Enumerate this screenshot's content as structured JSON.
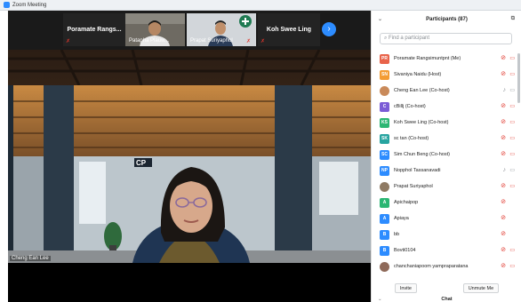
{
  "window": {
    "title": "Zoom Meeting"
  },
  "gallery": {
    "tiles": [
      {
        "name": "Poramate Rangs...",
        "muted": true
      },
      {
        "name": "Patapha Plauw...",
        "muted": true
      },
      {
        "name": "Prapat Suriyaphol",
        "muted": true
      },
      {
        "name": "Koh Swee Ling",
        "muted": true
      }
    ],
    "next_icon": "chevron-right-icon"
  },
  "main_video": {
    "speaker_name": "Cheng Ean Lee"
  },
  "participants_panel": {
    "title": "Participants (87)",
    "search_placeholder": "Find a participant",
    "participants": [
      {
        "initials": "PR",
        "name": "Poramate Rangsimuntpnt (Me)",
        "color": "#e8634a",
        "photo": false,
        "mic": "muted",
        "cam": "muted"
      },
      {
        "initials": "SN",
        "name": "Sivaniya Naidu (Host)",
        "color": "#f39c34",
        "photo": false,
        "mic": "muted",
        "cam": "muted"
      },
      {
        "initials": "",
        "name": "Cheng Ean Lee (Co-host)",
        "color": "#c98a5a",
        "photo": true,
        "mic": "on",
        "cam": "on"
      },
      {
        "initials": "C",
        "name": "cBillj (Co-host)",
        "color": "#7b5cd6",
        "photo": false,
        "mic": "muted",
        "cam": "muted"
      },
      {
        "initials": "KS",
        "name": "Koh Swee Ling (Co-host)",
        "color": "#2bb673",
        "photo": false,
        "mic": "muted",
        "cam": "muted"
      },
      {
        "initials": "SK",
        "name": "sc tan (Co-host)",
        "color": "#27a4a0",
        "photo": false,
        "mic": "muted",
        "cam": "muted"
      },
      {
        "initials": "SC",
        "name": "Sim Chun Beng (Co-host)",
        "color": "#2d8cff",
        "photo": false,
        "mic": "muted",
        "cam": "muted"
      },
      {
        "initials": "NP",
        "name": "Nopphol Tassanavadi",
        "color": "#2d8cff",
        "photo": false,
        "mic": "on",
        "cam": "on"
      },
      {
        "initials": "",
        "name": "Prapat Suriyaphol",
        "color": "#8f7a63",
        "photo": true,
        "mic": "muted",
        "cam": "muted"
      },
      {
        "initials": "A",
        "name": "Apichaipop",
        "color": "#2bb673",
        "photo": false,
        "mic": "muted",
        "cam": "none"
      },
      {
        "initials": "A",
        "name": "Apiaya",
        "color": "#2d8cff",
        "photo": false,
        "mic": "muted",
        "cam": "none"
      },
      {
        "initials": "B",
        "name": "bb",
        "color": "#2d8cff",
        "photo": false,
        "mic": "muted",
        "cam": "none"
      },
      {
        "initials": "B",
        "name": "Bovti0104",
        "color": "#2d8cff",
        "photo": false,
        "mic": "muted",
        "cam": "muted"
      },
      {
        "initials": "",
        "name": "chanchaniapoom yampraparatana",
        "color": "#8f6a5a",
        "photo": true,
        "mic": "muted",
        "cam": "muted"
      }
    ],
    "invite_label": "Invite",
    "unmute_label": "Unmute Me",
    "chat_label": "Chat"
  },
  "colors": {
    "accent": "#2d8cff",
    "muted_red": "#e0362c"
  }
}
